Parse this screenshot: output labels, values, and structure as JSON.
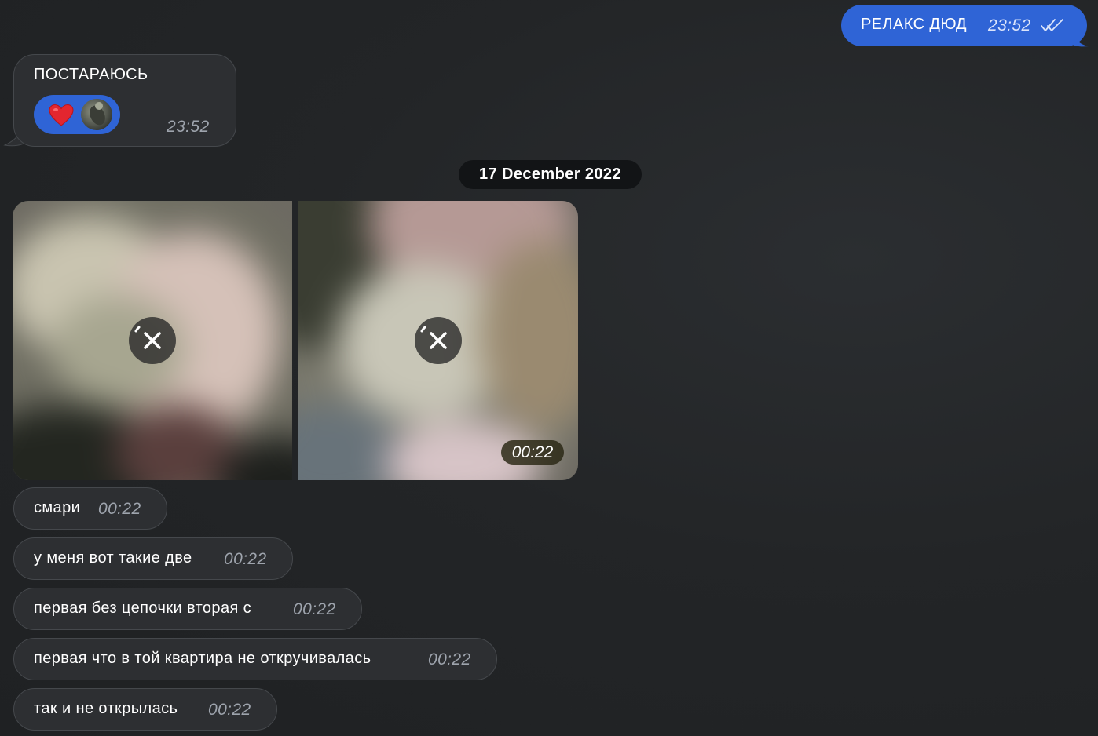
{
  "outgoing": {
    "text": "РЕЛАКС ДЮД",
    "time": "23:52",
    "status_icon": "double-check-icon"
  },
  "incoming_first": {
    "text": "ПОСТАРАЮСЬ",
    "time": "23:52",
    "reaction": {
      "emoji": "❤️",
      "reactor": "avatar"
    }
  },
  "date_separator": "17 December 2022",
  "media_album": {
    "items": [
      {
        "name": "photo-1",
        "action_icon": "cancel-download-icon"
      },
      {
        "name": "photo-2",
        "action_icon": "cancel-download-icon"
      }
    ],
    "time": "00:22"
  },
  "messages": [
    {
      "text": "смари",
      "time": "00:22"
    },
    {
      "text": "у меня вот такие две",
      "time": "00:22"
    },
    {
      "text": "первая без цепочки вторая с",
      "time": "00:22"
    },
    {
      "text": "первая что в той квартира не откручивалась",
      "time": "00:22"
    },
    {
      "text": "так и не открылась",
      "time": "00:22"
    }
  ],
  "colors": {
    "background": "#232527",
    "outgoing_bubble": "#2f64d6",
    "incoming_bubble": "#2d2f32",
    "reaction_pill": "#2f64d6",
    "date_pill": "#121416",
    "time_text": "#9ea4ad"
  }
}
